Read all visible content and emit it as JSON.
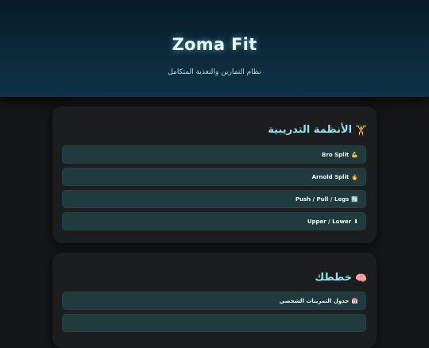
{
  "header": {
    "title": "Zoma Fit",
    "subtitle": "نظام التمارين والتغذية المتكامل"
  },
  "systems": {
    "title": "الأنظمة التدريبية",
    "icon": "🏋",
    "items": [
      {
        "label": "Bro Split",
        "icon": "💪"
      },
      {
        "label": "Arnold Split",
        "icon": "🔥"
      },
      {
        "label": "Push / Pull / Legs",
        "icon": "🔄"
      },
      {
        "label": "Upper / Lower",
        "icon": "⬇"
      }
    ]
  },
  "plans": {
    "title": "خططك",
    "icon": "🧠",
    "items": [
      {
        "label": "جدول التمرينات الشخصي",
        "icon": "📅"
      }
    ]
  },
  "colors": {
    "accent": "#8fe3ee",
    "header_bg": "#0c2a3c",
    "item_bg": "#1f3b3d",
    "page_bg": "#141617"
  }
}
